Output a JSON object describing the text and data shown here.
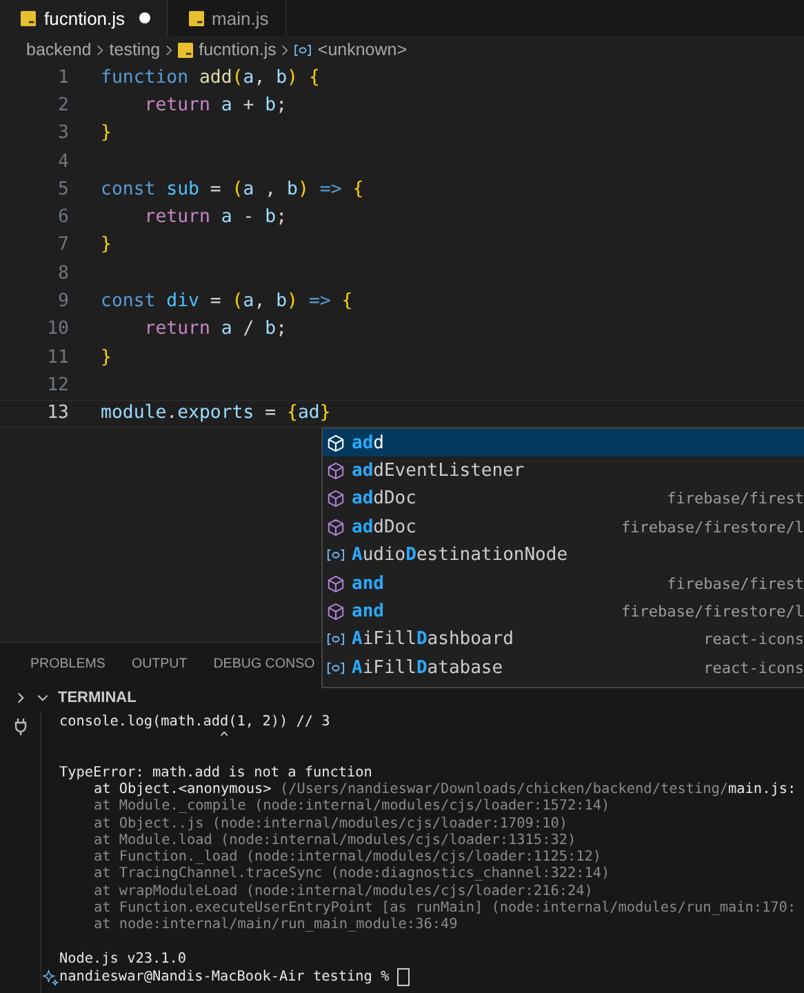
{
  "tabs": [
    {
      "label": "fucntion.js",
      "selected": true,
      "modified": true
    },
    {
      "label": "main.js",
      "selected": false,
      "modified": false
    }
  ],
  "breadcrumb": [
    {
      "text": "backend",
      "kind": "folder"
    },
    {
      "text": "testing",
      "kind": "folder"
    },
    {
      "text": "fucntion.js",
      "kind": "file"
    },
    {
      "text": "<unknown>",
      "kind": "symbol"
    }
  ],
  "code": [
    {
      "number": "1",
      "current": false,
      "tokens": [
        {
          "text": "function ",
          "kind": "kw"
        },
        {
          "text": "add",
          "kind": "fn"
        },
        {
          "text": "(",
          "kind": "br"
        },
        {
          "text": "a",
          "kind": "var"
        },
        {
          "text": ", ",
          "kind": "plain"
        },
        {
          "text": "b",
          "kind": "var"
        },
        {
          "text": ") ",
          "kind": "br"
        },
        {
          "text": "{",
          "kind": "br"
        }
      ]
    },
    {
      "number": "2",
      "current": false,
      "tokens": [
        {
          "text": "    return ",
          "kind": "ctl"
        },
        {
          "text": "a",
          "kind": "var"
        },
        {
          "text": " + ",
          "kind": "plain"
        },
        {
          "text": "b",
          "kind": "var"
        },
        {
          "text": ";",
          "kind": "plain"
        }
      ]
    },
    {
      "number": "3",
      "current": false,
      "tokens": [
        {
          "text": "}",
          "kind": "br"
        }
      ]
    },
    {
      "number": "4",
      "current": false
    },
    {
      "number": "5",
      "current": false,
      "tokens": [
        {
          "text": "const ",
          "kind": "kw"
        },
        {
          "text": "sub",
          "kind": "const"
        },
        {
          "text": " = ",
          "kind": "plain"
        },
        {
          "text": "(",
          "kind": "br"
        },
        {
          "text": "a",
          "kind": "var"
        },
        {
          "text": " , ",
          "kind": "plain"
        },
        {
          "text": "b",
          "kind": "var"
        },
        {
          "text": ") ",
          "kind": "br"
        },
        {
          "text": "=> ",
          "kind": "kw"
        },
        {
          "text": "{",
          "kind": "br"
        }
      ]
    },
    {
      "number": "6",
      "current": false,
      "tokens": [
        {
          "text": "    return ",
          "kind": "ctl"
        },
        {
          "text": "a",
          "kind": "var"
        },
        {
          "text": " - ",
          "kind": "plain"
        },
        {
          "text": "b",
          "kind": "var"
        },
        {
          "text": ";",
          "kind": "plain"
        }
      ]
    },
    {
      "number": "7",
      "current": false,
      "tokens": [
        {
          "text": "}",
          "kind": "br"
        }
      ]
    },
    {
      "number": "8",
      "current": false
    },
    {
      "number": "9",
      "current": false,
      "tokens": [
        {
          "text": "const ",
          "kind": "kw"
        },
        {
          "text": "div",
          "kind": "const"
        },
        {
          "text": " = ",
          "kind": "plain"
        },
        {
          "text": "(",
          "kind": "br"
        },
        {
          "text": "a",
          "kind": "var"
        },
        {
          "text": ", ",
          "kind": "plain"
        },
        {
          "text": "b",
          "kind": "var"
        },
        {
          "text": ") ",
          "kind": "br"
        },
        {
          "text": "=> ",
          "kind": "kw"
        },
        {
          "text": "{",
          "kind": "br"
        }
      ]
    },
    {
      "number": "10",
      "current": false,
      "tokens": [
        {
          "text": "    return ",
          "kind": "ctl"
        },
        {
          "text": "a",
          "kind": "var"
        },
        {
          "text": " / ",
          "kind": "plain"
        },
        {
          "text": "b",
          "kind": "var"
        },
        {
          "text": ";",
          "kind": "plain"
        }
      ]
    },
    {
      "number": "11",
      "current": false,
      "tokens": [
        {
          "text": "}",
          "kind": "br"
        }
      ]
    },
    {
      "number": "12",
      "current": false
    },
    {
      "number": "13",
      "current": true,
      "tokens": [
        {
          "text": "module",
          "kind": "var"
        },
        {
          "text": ".",
          "kind": "plain"
        },
        {
          "text": "exports",
          "kind": "var"
        },
        {
          "text": " = ",
          "kind": "plain"
        },
        {
          "text": "{",
          "kind": "br"
        },
        {
          "text": "ad",
          "kind": "var"
        },
        {
          "text": "}",
          "kind": "br"
        }
      ]
    }
  ],
  "suggestions": [
    {
      "kind": "method",
      "selected": true,
      "parts": [
        {
          "text": "ad",
          "match": true
        },
        {
          "text": "d",
          "match": false
        }
      ]
    },
    {
      "kind": "method",
      "selected": false,
      "parts": [
        {
          "text": "ad",
          "match": true
        },
        {
          "text": "dEventListener",
          "match": false
        }
      ]
    },
    {
      "kind": "method",
      "selected": false,
      "parts": [
        {
          "text": "ad",
          "match": true
        },
        {
          "text": "dDoc",
          "match": false
        }
      ],
      "detail": "firebase/firest"
    },
    {
      "kind": "method",
      "selected": false,
      "parts": [
        {
          "text": "ad",
          "match": true
        },
        {
          "text": "dDoc",
          "match": false
        }
      ],
      "detail": "firebase/firestore/l"
    },
    {
      "kind": "variable",
      "selected": false,
      "parts": [
        {
          "text": "A",
          "match": true
        },
        {
          "text": "udio",
          "match": false
        },
        {
          "text": "D",
          "match": true
        },
        {
          "text": "estinationNode",
          "match": false
        }
      ]
    },
    {
      "kind": "method",
      "selected": false,
      "parts": [
        {
          "text": "and",
          "match": true
        }
      ],
      "detail": "firebase/firest"
    },
    {
      "kind": "method",
      "selected": false,
      "parts": [
        {
          "text": "and",
          "match": true
        }
      ],
      "detail": "firebase/firestore/l"
    },
    {
      "kind": "variable",
      "selected": false,
      "parts": [
        {
          "text": "A",
          "match": true
        },
        {
          "text": "iFill",
          "match": false
        },
        {
          "text": "D",
          "match": true
        },
        {
          "text": "ashboard",
          "match": false
        }
      ],
      "detail": "react-icons"
    },
    {
      "kind": "variable",
      "selected": false,
      "parts": [
        {
          "text": "A",
          "match": true
        },
        {
          "text": "iFill",
          "match": false
        },
        {
          "text": "D",
          "match": true
        },
        {
          "text": "atabase",
          "match": false
        }
      ],
      "detail": "react-icons"
    }
  ],
  "panel_tabs": [
    "PROBLEMS",
    "OUTPUT",
    "DEBUG CONSO"
  ],
  "terminal": {
    "title": "TERMINAL",
    "expanded": true,
    "lines": [
      {
        "segments": [
          {
            "text": "console.log(math.add(1, 2)) // 3",
            "dim": false
          }
        ]
      },
      {
        "segments": [
          {
            "text": "                   ^",
            "dim": false
          }
        ]
      },
      {
        "gap_before": true,
        "segments": [
          {
            "text": "TypeError: math.add is not a function",
            "dim": false
          }
        ]
      },
      {
        "indent": true,
        "segments": [
          {
            "text": "at Object.<anonymous>",
            "dim": false
          },
          {
            "text": " (/Users/nandieswar/Downloads/chicken/backend/testing/",
            "dim": true
          },
          {
            "text": "main.js:",
            "dim": false
          }
        ]
      },
      {
        "indent": true,
        "segments": [
          {
            "text": "at Module._compile (node:internal/modules/cjs/loader:1572:14)",
            "dim": true
          }
        ]
      },
      {
        "indent": true,
        "segments": [
          {
            "text": "at Object..js (node:internal/modules/cjs/loader:1709:10)",
            "dim": true
          }
        ]
      },
      {
        "indent": true,
        "segments": [
          {
            "text": "at Module.load (node:internal/modules/cjs/loader:1315:32)",
            "dim": true
          }
        ]
      },
      {
        "indent": true,
        "segments": [
          {
            "text": "at Function._load (node:internal/modules/cjs/loader:1125:12)",
            "dim": true
          }
        ]
      },
      {
        "indent": true,
        "segments": [
          {
            "text": "at TracingChannel.traceSync (node:diagnostics_channel:322:14)",
            "dim": true
          }
        ]
      },
      {
        "indent": true,
        "segments": [
          {
            "text": "at wrapModuleLoad (node:internal/modules/cjs/loader:216:24)",
            "dim": true
          }
        ]
      },
      {
        "indent": true,
        "segments": [
          {
            "text": "at Function.executeUserEntryPoint [as runMain] (node:internal/modules/run_main:170:",
            "dim": true
          }
        ]
      },
      {
        "indent": true,
        "segments": [
          {
            "text": "at node:internal/main/run_main_module:36:49",
            "dim": true
          }
        ]
      },
      {
        "gap_before": true,
        "segments": [
          {
            "text": "Node.js v23.1.0",
            "dim": false
          }
        ]
      }
    ],
    "prompt": "nandieswar@Nandis-MacBook-Air testing % "
  }
}
